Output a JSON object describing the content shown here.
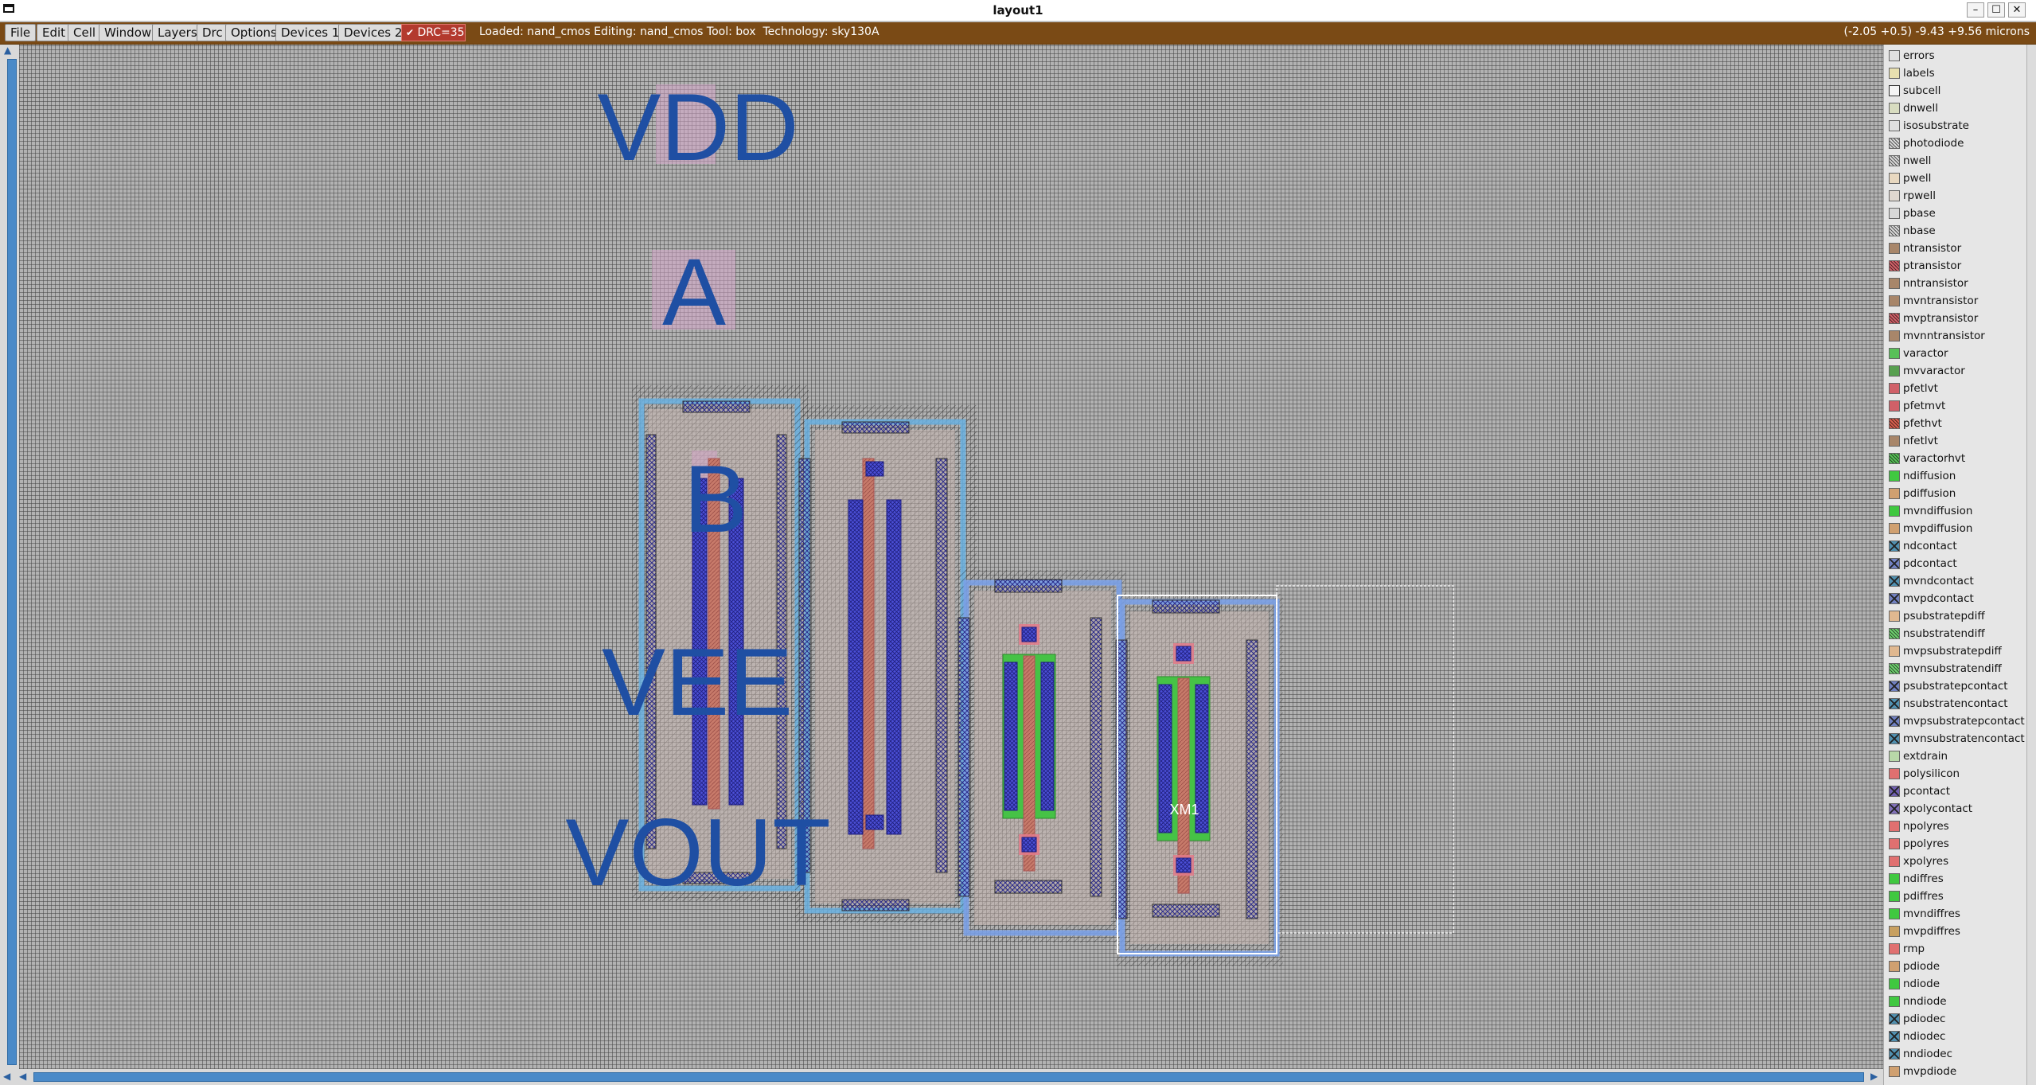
{
  "window": {
    "title": "layout1"
  },
  "menu": [
    "File",
    "Edit",
    "Cell",
    "Window",
    "Layers",
    "Drc",
    "Options",
    "Devices 1",
    "Devices 2"
  ],
  "drc": {
    "label": "DRC=35",
    "checked": true
  },
  "status": {
    "text": "Loaded: nand_cmos Editing: nand_cmos Tool: box  Technology: sky130A",
    "coords": "(-2.05 +0.5) -9.43 +9.56 microns"
  },
  "canvas_labels": {
    "vdd": "VDD",
    "a": "A",
    "b": "B",
    "vee": "VEE",
    "vout": "VOUT",
    "xm1": "XM1"
  },
  "layers": [
    {
      "name": "errors",
      "color": "#e0e0e0",
      "style": "plain"
    },
    {
      "name": "labels",
      "color": "#e8e0b0",
      "style": "plain"
    },
    {
      "name": "subcell",
      "color": "#f0f0f0",
      "style": "outline"
    },
    {
      "name": "dnwell",
      "color": "#d8dcc0",
      "style": "plain"
    },
    {
      "name": "isosubstrate",
      "color": "#e0e0e0",
      "style": "plain"
    },
    {
      "name": "photodiode",
      "color": "#d8d8d8",
      "style": "hatch"
    },
    {
      "name": "nwell",
      "color": "#d8d8d8",
      "style": "hatch"
    },
    {
      "name": "pwell",
      "color": "#e8d8c0",
      "style": "plain"
    },
    {
      "name": "rpwell",
      "color": "#e0d8d0",
      "style": "plain"
    },
    {
      "name": "pbase",
      "color": "#d8d8d8",
      "style": "plain"
    },
    {
      "name": "nbase",
      "color": "#d8d8d8",
      "style": "hatch"
    },
    {
      "name": "ntransistor",
      "color": "#a8866a",
      "style": "plain"
    },
    {
      "name": "ptransistor",
      "color": "#d06068",
      "style": "hatch"
    },
    {
      "name": "nntransistor",
      "color": "#a8866a",
      "style": "plain"
    },
    {
      "name": "mvntransistor",
      "color": "#a8866a",
      "style": "plain"
    },
    {
      "name": "mvptransistor",
      "color": "#d06068",
      "style": "hatch"
    },
    {
      "name": "mvnntransistor",
      "color": "#a8866a",
      "style": "plain"
    },
    {
      "name": "varactor",
      "color": "#58c058",
      "style": "plain"
    },
    {
      "name": "mvvaractor",
      "color": "#58a050",
      "style": "plain"
    },
    {
      "name": "pfetlvt",
      "color": "#d06068",
      "style": "plain"
    },
    {
      "name": "pfetmvt",
      "color": "#d06068",
      "style": "plain"
    },
    {
      "name": "pfethvt",
      "color": "#d86050",
      "style": "hatch"
    },
    {
      "name": "nfetlvt",
      "color": "#a8866a",
      "style": "plain"
    },
    {
      "name": "varactorhvt",
      "color": "#58c058",
      "style": "hatch"
    },
    {
      "name": "ndiffusion",
      "color": "#40c840",
      "style": "plain"
    },
    {
      "name": "pdiffusion",
      "color": "#d0a070",
      "style": "plain"
    },
    {
      "name": "mvndiffusion",
      "color": "#40c840",
      "style": "plain"
    },
    {
      "name": "mvpdiffusion",
      "color": "#d0a070",
      "style": "plain"
    },
    {
      "name": "ndcontact",
      "color": "#5090b0",
      "style": "cross"
    },
    {
      "name": "pdcontact",
      "color": "#7080c0",
      "style": "cross"
    },
    {
      "name": "mvndcontact",
      "color": "#5090b0",
      "style": "cross"
    },
    {
      "name": "mvpdcontact",
      "color": "#7080c0",
      "style": "cross"
    },
    {
      "name": "psubstratepdiff",
      "color": "#e0b890",
      "style": "plain"
    },
    {
      "name": "nsubstratendiff",
      "color": "#70d070",
      "style": "hatch"
    },
    {
      "name": "mvpsubstratepdiff",
      "color": "#e0b890",
      "style": "plain"
    },
    {
      "name": "mvnsubstratendiff",
      "color": "#70d070",
      "style": "hatch"
    },
    {
      "name": "psubstratepcontact",
      "color": "#7080c0",
      "style": "cross"
    },
    {
      "name": "nsubstratencontact",
      "color": "#5090b0",
      "style": "cross"
    },
    {
      "name": "mvpsubstratepcontact",
      "color": "#7080c0",
      "style": "cross"
    },
    {
      "name": "mvnsubstratencontact",
      "color": "#5090b0",
      "style": "cross"
    },
    {
      "name": "extdrain",
      "color": "#b8d8a8",
      "style": "plain"
    },
    {
      "name": "polysilicon",
      "color": "#e07070",
      "style": "plain"
    },
    {
      "name": "pcontact",
      "color": "#7060b0",
      "style": "cross"
    },
    {
      "name": "xpolycontact",
      "color": "#8070b8",
      "style": "cross"
    },
    {
      "name": "npolyres",
      "color": "#e07070",
      "style": "plain"
    },
    {
      "name": "ppolyres",
      "color": "#e07070",
      "style": "plain"
    },
    {
      "name": "xpolyres",
      "color": "#e07070",
      "style": "plain"
    },
    {
      "name": "ndiffres",
      "color": "#40c840",
      "style": "plain"
    },
    {
      "name": "pdiffres",
      "color": "#40c840",
      "style": "plain"
    },
    {
      "name": "mvndiffres",
      "color": "#40c840",
      "style": "plain"
    },
    {
      "name": "mvpdiffres",
      "color": "#c8a060",
      "style": "plain"
    },
    {
      "name": "rmp",
      "color": "#e07070",
      "style": "plain"
    },
    {
      "name": "pdiode",
      "color": "#d0a070",
      "style": "plain"
    },
    {
      "name": "ndiode",
      "color": "#40c840",
      "style": "plain"
    },
    {
      "name": "nndiode",
      "color": "#40c840",
      "style": "plain"
    },
    {
      "name": "pdiodec",
      "color": "#5090b0",
      "style": "cross"
    },
    {
      "name": "ndiodec",
      "color": "#5090b0",
      "style": "cross"
    },
    {
      "name": "nndiodec",
      "color": "#5090b0",
      "style": "cross"
    },
    {
      "name": "mvpdiode",
      "color": "#d0a070",
      "style": "plain"
    }
  ]
}
